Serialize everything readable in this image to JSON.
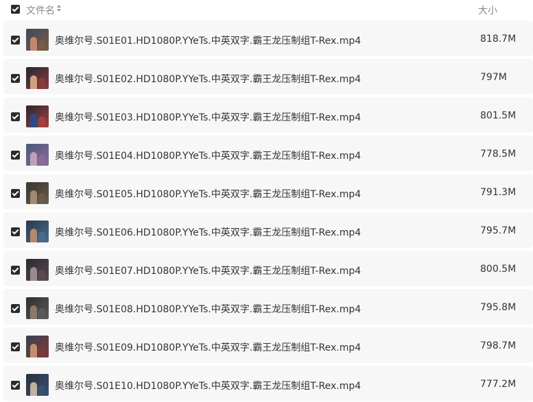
{
  "header": {
    "name_label": "文件名",
    "size_label": "大小",
    "select_all_checked": true,
    "sort_icon": "sort-icon"
  },
  "files": [
    {
      "name": "奥维尔号.S01E01.HD1080P.YYeTs.中英双字.霸王龙压制组T-Rex.mp4",
      "size": "818.7M",
      "checked": true,
      "thumb_colors": [
        "#3a4a5c",
        "#7a5a45",
        "#c08a6a"
      ]
    },
    {
      "name": "奥维尔号.S01E02.HD1080P.YYeTs.中英双字.霸王龙压制组T-Rex.mp4",
      "size": "797M",
      "checked": true,
      "thumb_colors": [
        "#1f2a33",
        "#8a3a3a",
        "#d0a080"
      ]
    },
    {
      "name": "奥维尔号.S01E03.HD1080P.YYeTs.中英双字.霸王龙压制组T-Rex.mp4",
      "size": "801.5M",
      "checked": true,
      "thumb_colors": [
        "#2a2530",
        "#a04040",
        "#2f4a80"
      ]
    },
    {
      "name": "奥维尔号.S01E04.HD1080P.YYeTs.中英双字.霸王龙压制组T-Rex.mp4",
      "size": "778.5M",
      "checked": true,
      "thumb_colors": [
        "#4a5a7a",
        "#8a6a9a",
        "#c0a0b0"
      ]
    },
    {
      "name": "奥维尔号.S01E05.HD1080P.YYeTs.中英双字.霸王龙压制组T-Rex.mp4",
      "size": "791.3M",
      "checked": true,
      "thumb_colors": [
        "#3a3630",
        "#6a5a48",
        "#a08a70"
      ]
    },
    {
      "name": "奥维尔号.S01E06.HD1080P.YYeTs.中英双字.霸王龙压制组T-Rex.mp4",
      "size": "795.7M",
      "checked": true,
      "thumb_colors": [
        "#2a3a4a",
        "#4a6a8a",
        "#b08a70"
      ]
    },
    {
      "name": "奥维尔号.S01E07.HD1080P.YYeTs.中英双字.霸王龙压制组T-Rex.mp4",
      "size": "800.5M",
      "checked": true,
      "thumb_colors": [
        "#2a2a30",
        "#5a4a50",
        "#9a8a8a"
      ]
    },
    {
      "name": "奥维尔号.S01E08.HD1080P.YYeTs.中英双字.霸王龙压制组T-Rex.mp4",
      "size": "795.8M",
      "checked": true,
      "thumb_colors": [
        "#2e2e2e",
        "#5a5a5a",
        "#8a7a6a"
      ]
    },
    {
      "name": "奥维尔号.S01E09.HD1080P.YYeTs.中英双字.霸王龙压制组T-Rex.mp4",
      "size": "798.7M",
      "checked": true,
      "thumb_colors": [
        "#3a4050",
        "#7a3a3a",
        "#c09070"
      ]
    },
    {
      "name": "奥维尔号.S01E10.HD1080P.YYeTs.中英双字.霸王龙压制组T-Rex.mp4",
      "size": "777.2M",
      "checked": true,
      "thumb_colors": [
        "#2a3040",
        "#3a5070",
        "#c0b0a0"
      ]
    }
  ]
}
